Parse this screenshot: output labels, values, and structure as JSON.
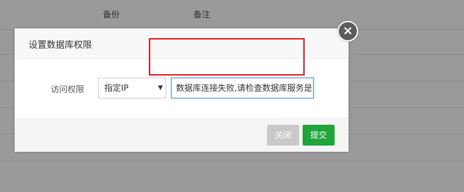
{
  "background_table": {
    "columns": [
      "备份",
      "备注"
    ]
  },
  "dialog": {
    "title": "设置数据库权限",
    "field_label": "访问权限",
    "select_value": "指定IP",
    "input_value": "数据库连接失败,请检查数据库服务是",
    "close_icon": "×",
    "buttons": {
      "close": "关闭",
      "submit": "提交"
    }
  },
  "colors": {
    "submit_button": "#20a53a",
    "close_button": "#c9c9c9",
    "highlight": "#e02020"
  }
}
